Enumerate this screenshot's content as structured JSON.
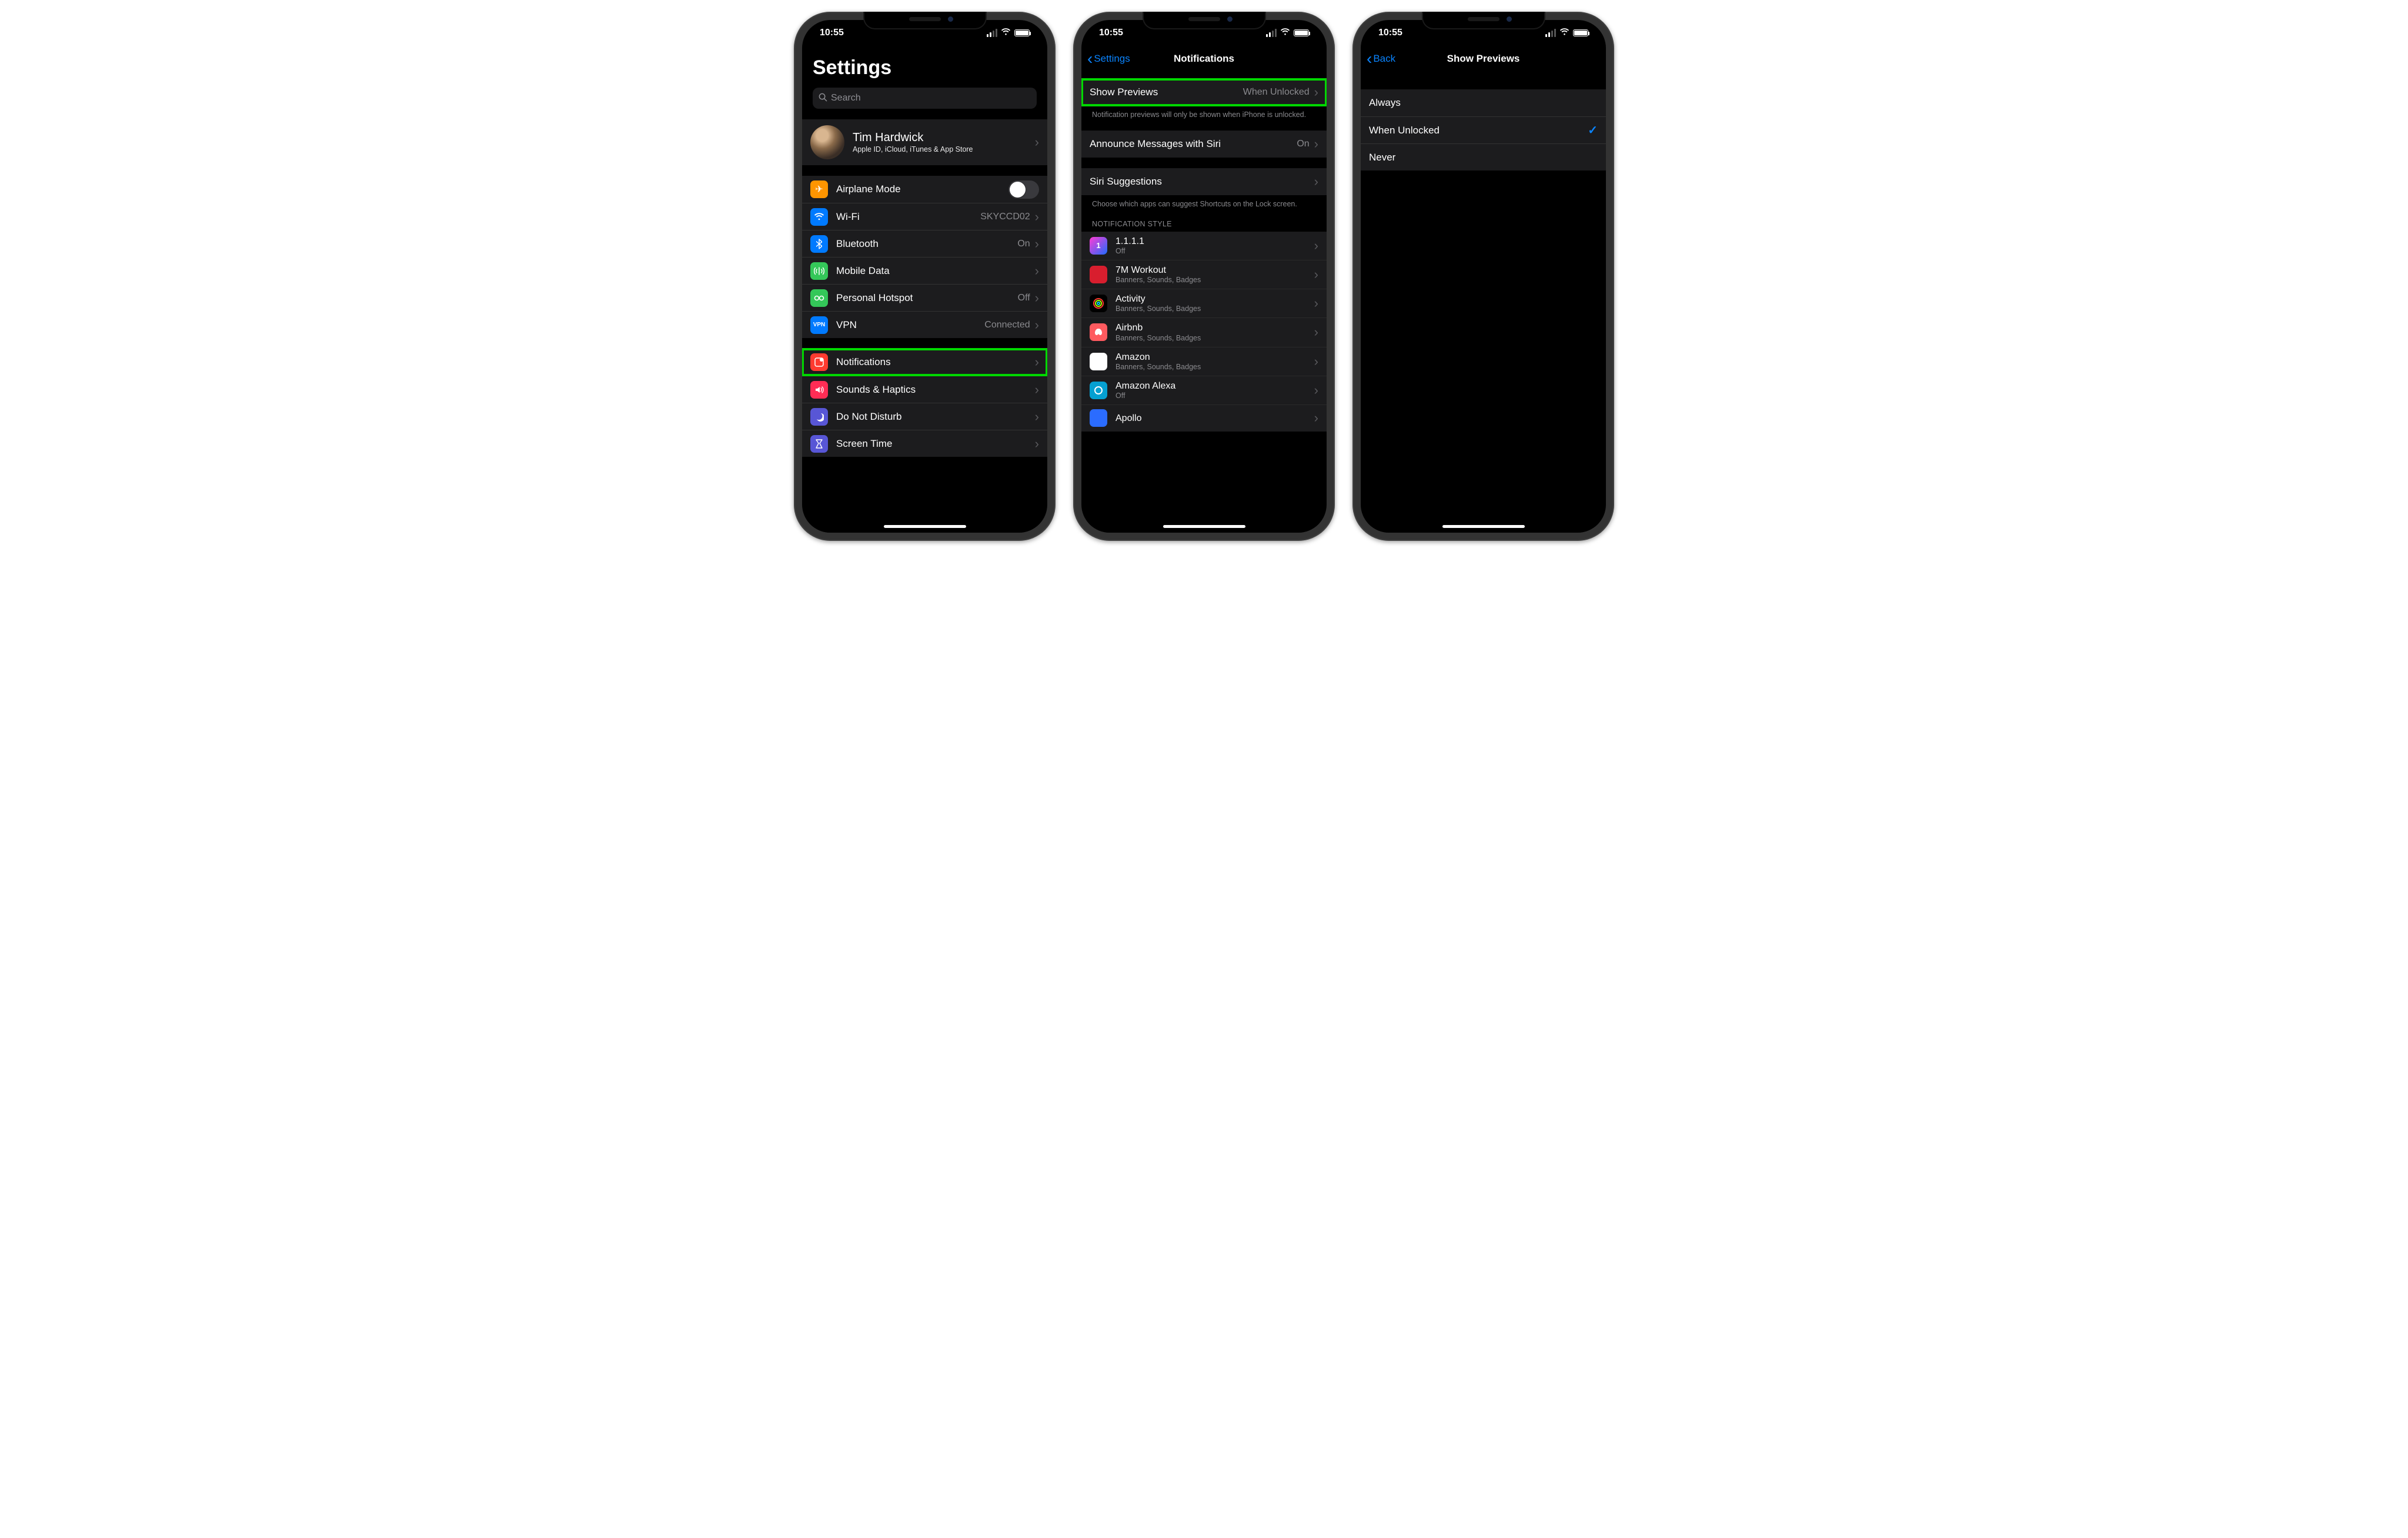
{
  "status": {
    "time": "10:55"
  },
  "phone1": {
    "title": "Settings",
    "search_placeholder": "Search",
    "profile": {
      "name": "Tim Hardwick",
      "sub": "Apple ID, iCloud, iTunes & App Store"
    },
    "group_net": {
      "airplane": "Airplane Mode",
      "wifi": "Wi-Fi",
      "wifi_val": "SKYCCD02",
      "bt": "Bluetooth",
      "bt_val": "On",
      "mobile": "Mobile Data",
      "hotspot": "Personal Hotspot",
      "hotspot_val": "Off",
      "vpn": "VPN",
      "vpn_badge": "VPN",
      "vpn_val": "Connected"
    },
    "group_notif": {
      "notifications": "Notifications",
      "sounds": "Sounds & Haptics",
      "dnd": "Do Not Disturb",
      "screentime": "Screen Time"
    }
  },
  "phone2": {
    "back": "Settings",
    "title": "Notifications",
    "previews": "Show Previews",
    "previews_val": "When Unlocked",
    "previews_footer": "Notification previews will only be shown when iPhone is unlocked.",
    "announce": "Announce Messages with Siri",
    "announce_val": "On",
    "siri": "Siri Suggestions",
    "siri_footer": "Choose which apps can suggest Shortcuts on the Lock screen.",
    "style_header": "Notification Style",
    "apps": [
      {
        "name": "1.1.1.1",
        "sub": "Off",
        "color": "linear-gradient(135deg,#ff3bd4,#1f6bff)"
      },
      {
        "name": "7M Workout",
        "sub": "Banners, Sounds, Badges",
        "color": "#d81e2e"
      },
      {
        "name": "Activity",
        "sub": "Banners, Sounds, Badges",
        "color": "#000"
      },
      {
        "name": "Airbnb",
        "sub": "Banners, Sounds, Badges",
        "color": "#ff5a5f"
      },
      {
        "name": "Amazon",
        "sub": "Banners, Sounds, Badges",
        "color": "#fff"
      },
      {
        "name": "Amazon Alexa",
        "sub": "Off",
        "color": "#05a0d1"
      },
      {
        "name": "Apollo",
        "sub": "",
        "color": "#2b6cff"
      }
    ]
  },
  "phone3": {
    "back": "Back",
    "title": "Show Previews",
    "options": [
      {
        "label": "Always",
        "selected": false
      },
      {
        "label": "When Unlocked",
        "selected": true
      },
      {
        "label": "Never",
        "selected": false
      }
    ]
  }
}
